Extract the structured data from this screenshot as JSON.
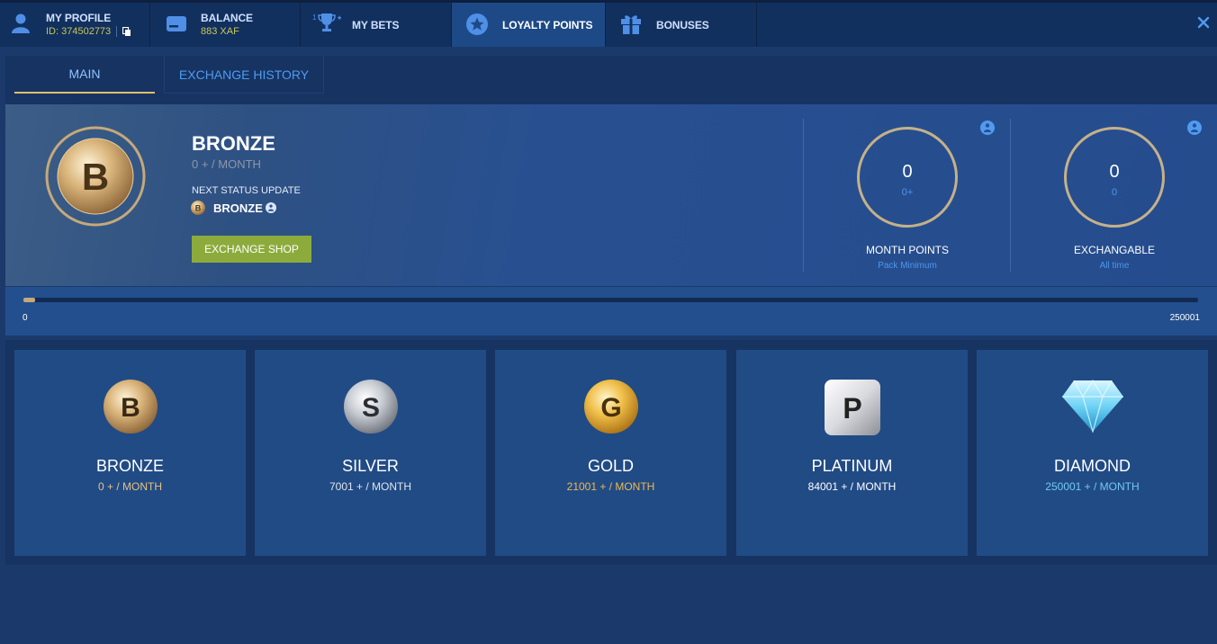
{
  "nav": {
    "profile": {
      "title": "MY PROFILE",
      "id_text": "ID: 374502773"
    },
    "balance": {
      "title": "BALANCE",
      "amount": "883 XAF"
    },
    "bets": {
      "title": "MY BETS"
    },
    "loyalty": {
      "title": "LOYALTY POINTS"
    },
    "bonuses": {
      "title": "BONUSES"
    },
    "active": "LOYALTY POINTS"
  },
  "subtabs": [
    {
      "label": "MAIN",
      "active": true
    },
    {
      "label": "EXCHANGE HISTORY",
      "active": false
    }
  ],
  "status": {
    "tier": "BRONZE",
    "tier_letter": "B",
    "range": "0 + / MONTH",
    "next_label": "NEXT STATUS UPDATE",
    "next_tier": "BRONZE",
    "next_letter": "B",
    "shop_button": "EXCHANGE SHOP"
  },
  "counters": [
    {
      "value": "0",
      "sub": "0+",
      "label": "MONTH POINTS",
      "hint": "Pack Minimum"
    },
    {
      "value": "0",
      "sub": "0",
      "label": "EXCHANGABLE",
      "hint": "All time"
    }
  ],
  "progress": {
    "min": "0",
    "max": "250001",
    "fraction": 0.01
  },
  "tiers": [
    {
      "name": "BRONZE",
      "letter": "B",
      "range": "0 + / MONTH",
      "range_color": "#e6c283"
    },
    {
      "name": "SILVER",
      "letter": "S",
      "range": "7001 + / MONTH",
      "range_color": "#e0e4ec"
    },
    {
      "name": "GOLD",
      "letter": "G",
      "range": "21001 + / MONTH",
      "range_color": "#ebb956"
    },
    {
      "name": "PLATINUM",
      "letter": "P",
      "range": "84001 + / MONTH",
      "range_color": "#ffffff"
    },
    {
      "name": "DIAMOND",
      "letter": "",
      "range": "250001 + / MONTH",
      "range_color": "#72c8f3"
    }
  ],
  "colors": {
    "accent_gold": "#e3bf67",
    "shop_button": "#8dab3c",
    "link_blue": "#4f9bf0",
    "page_bg": "#1b3a6b"
  },
  "icons": {
    "profile": "user-icon",
    "balance": "wallet-icon",
    "bets": "trophy-icon",
    "loyalty": "star-icon",
    "bonuses": "gift-icon",
    "copy": "copy-icon",
    "close": "close-icon",
    "info": "info-icon"
  }
}
